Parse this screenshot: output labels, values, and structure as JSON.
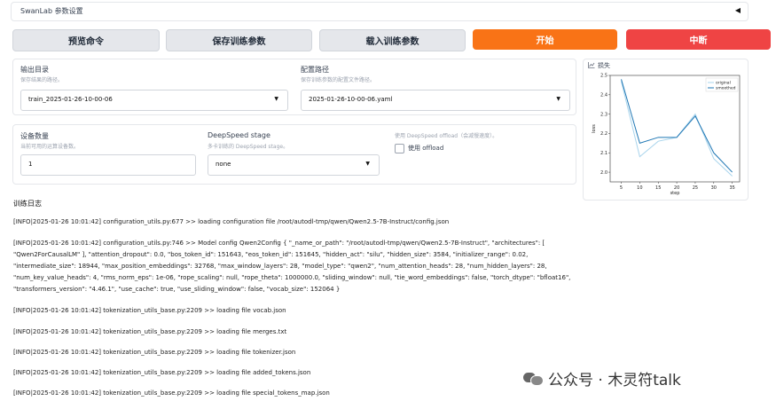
{
  "accordion": {
    "title": "SwanLab 参数设置",
    "toggle_glyph": "◀"
  },
  "buttons": {
    "preview": "预览命令",
    "save": "保存训练参数",
    "load": "载入训练参数",
    "start": "开始",
    "stop": "中断"
  },
  "output_dir": {
    "label": "输出目录",
    "info": "保存结果的路径。",
    "value": "train_2025-01-26-10-00-06"
  },
  "config_path": {
    "label": "配置路径",
    "info": "保存训练参数的配置文件路径。",
    "value": "2025-01-26-10-00-06.yaml"
  },
  "device_count": {
    "label": "设备数量",
    "info": "当前可用的运算设备数。",
    "value": "1"
  },
  "deepspeed": {
    "label": "DeepSpeed stage",
    "info": "多卡训练的 DeepSpeed stage。",
    "value": "none"
  },
  "offload": {
    "info": "使用 DeepSpeed offload（会减慢速度）。",
    "label": "使用 offload"
  },
  "plot": {
    "tab_label": "损失",
    "tab_icon": "line-chart-icon"
  },
  "chart_data": {
    "type": "line",
    "x": [
      5,
      10,
      15,
      20,
      25,
      30,
      35
    ],
    "series": [
      {
        "name": "original",
        "values": [
          2.47,
          2.08,
          2.16,
          2.18,
          2.3,
          2.07,
          1.98
        ],
        "color": "#a8d4ec"
      },
      {
        "name": "smoothed",
        "values": [
          2.48,
          2.15,
          2.18,
          2.18,
          2.29,
          2.1,
          2.0
        ],
        "color": "#1f77b4"
      }
    ],
    "xticks": [
      "5",
      "10",
      "15",
      "20",
      "25",
      "30",
      "35"
    ],
    "yticks": [
      "2.0",
      "2.1",
      "2.2",
      "2.3",
      "2.4",
      "2.5"
    ],
    "xlabel": "step",
    "ylabel": "loss",
    "xlim": [
      2,
      37
    ],
    "ylim": [
      1.95,
      2.5
    ],
    "legend_position": "top-right"
  },
  "log": {
    "title": "训练日志",
    "lines": [
      "[INFO|2025-01-26 10:01:42] configuration_utils.py:677 >> loading configuration file /root/autodl-tmp/qwen/Qwen2.5-7B-Instruct/config.json",
      "[INFO|2025-01-26 10:01:42] configuration_utils.py:746 >> Model config Qwen2Config { \"_name_or_path\": \"/root/autodl-tmp/qwen/Qwen2.5-7B-Instruct\", \"architectures\": [",
      "\"Qwen2ForCausalLM\" ], \"attention_dropout\": 0.0, \"bos_token_id\": 151643, \"eos_token_id\": 151645, \"hidden_act\": \"silu\", \"hidden_size\": 3584, \"initializer_range\": 0.02,",
      "\"intermediate_size\": 18944, \"max_position_embeddings\": 32768, \"max_window_layers\": 28, \"model_type\": \"qwen2\", \"num_attention_heads\": 28, \"num_hidden_layers\": 28,",
      "\"num_key_value_heads\": 4, \"rms_norm_eps\": 1e-06, \"rope_scaling\": null, \"rope_theta\": 1000000.0, \"sliding_window\": null, \"tie_word_embeddings\": false, \"torch_dtype\": \"bfloat16\",",
      "\"transformers_version\": \"4.46.1\", \"use_cache\": true, \"use_sliding_window\": false, \"vocab_size\": 152064 }",
      "[INFO|2025-01-26 10:01:42] tokenization_utils_base.py:2209 >> loading file vocab.json",
      "[INFO|2025-01-26 10:01:42] tokenization_utils_base.py:2209 >> loading file merges.txt",
      "[INFO|2025-01-26 10:01:42] tokenization_utils_base.py:2209 >> loading file tokenizer.json",
      "[INFO|2025-01-26 10:01:42] tokenization_utils_base.py:2209 >> loading file added_tokens.json",
      "[INFO|2025-01-26 10:01:42] tokenization_utils_base.py:2209 >> loading file special_tokens_map.json"
    ]
  },
  "watermark": {
    "text": "公众号 · 木灵符talk",
    "icon": "wechat-icon"
  }
}
